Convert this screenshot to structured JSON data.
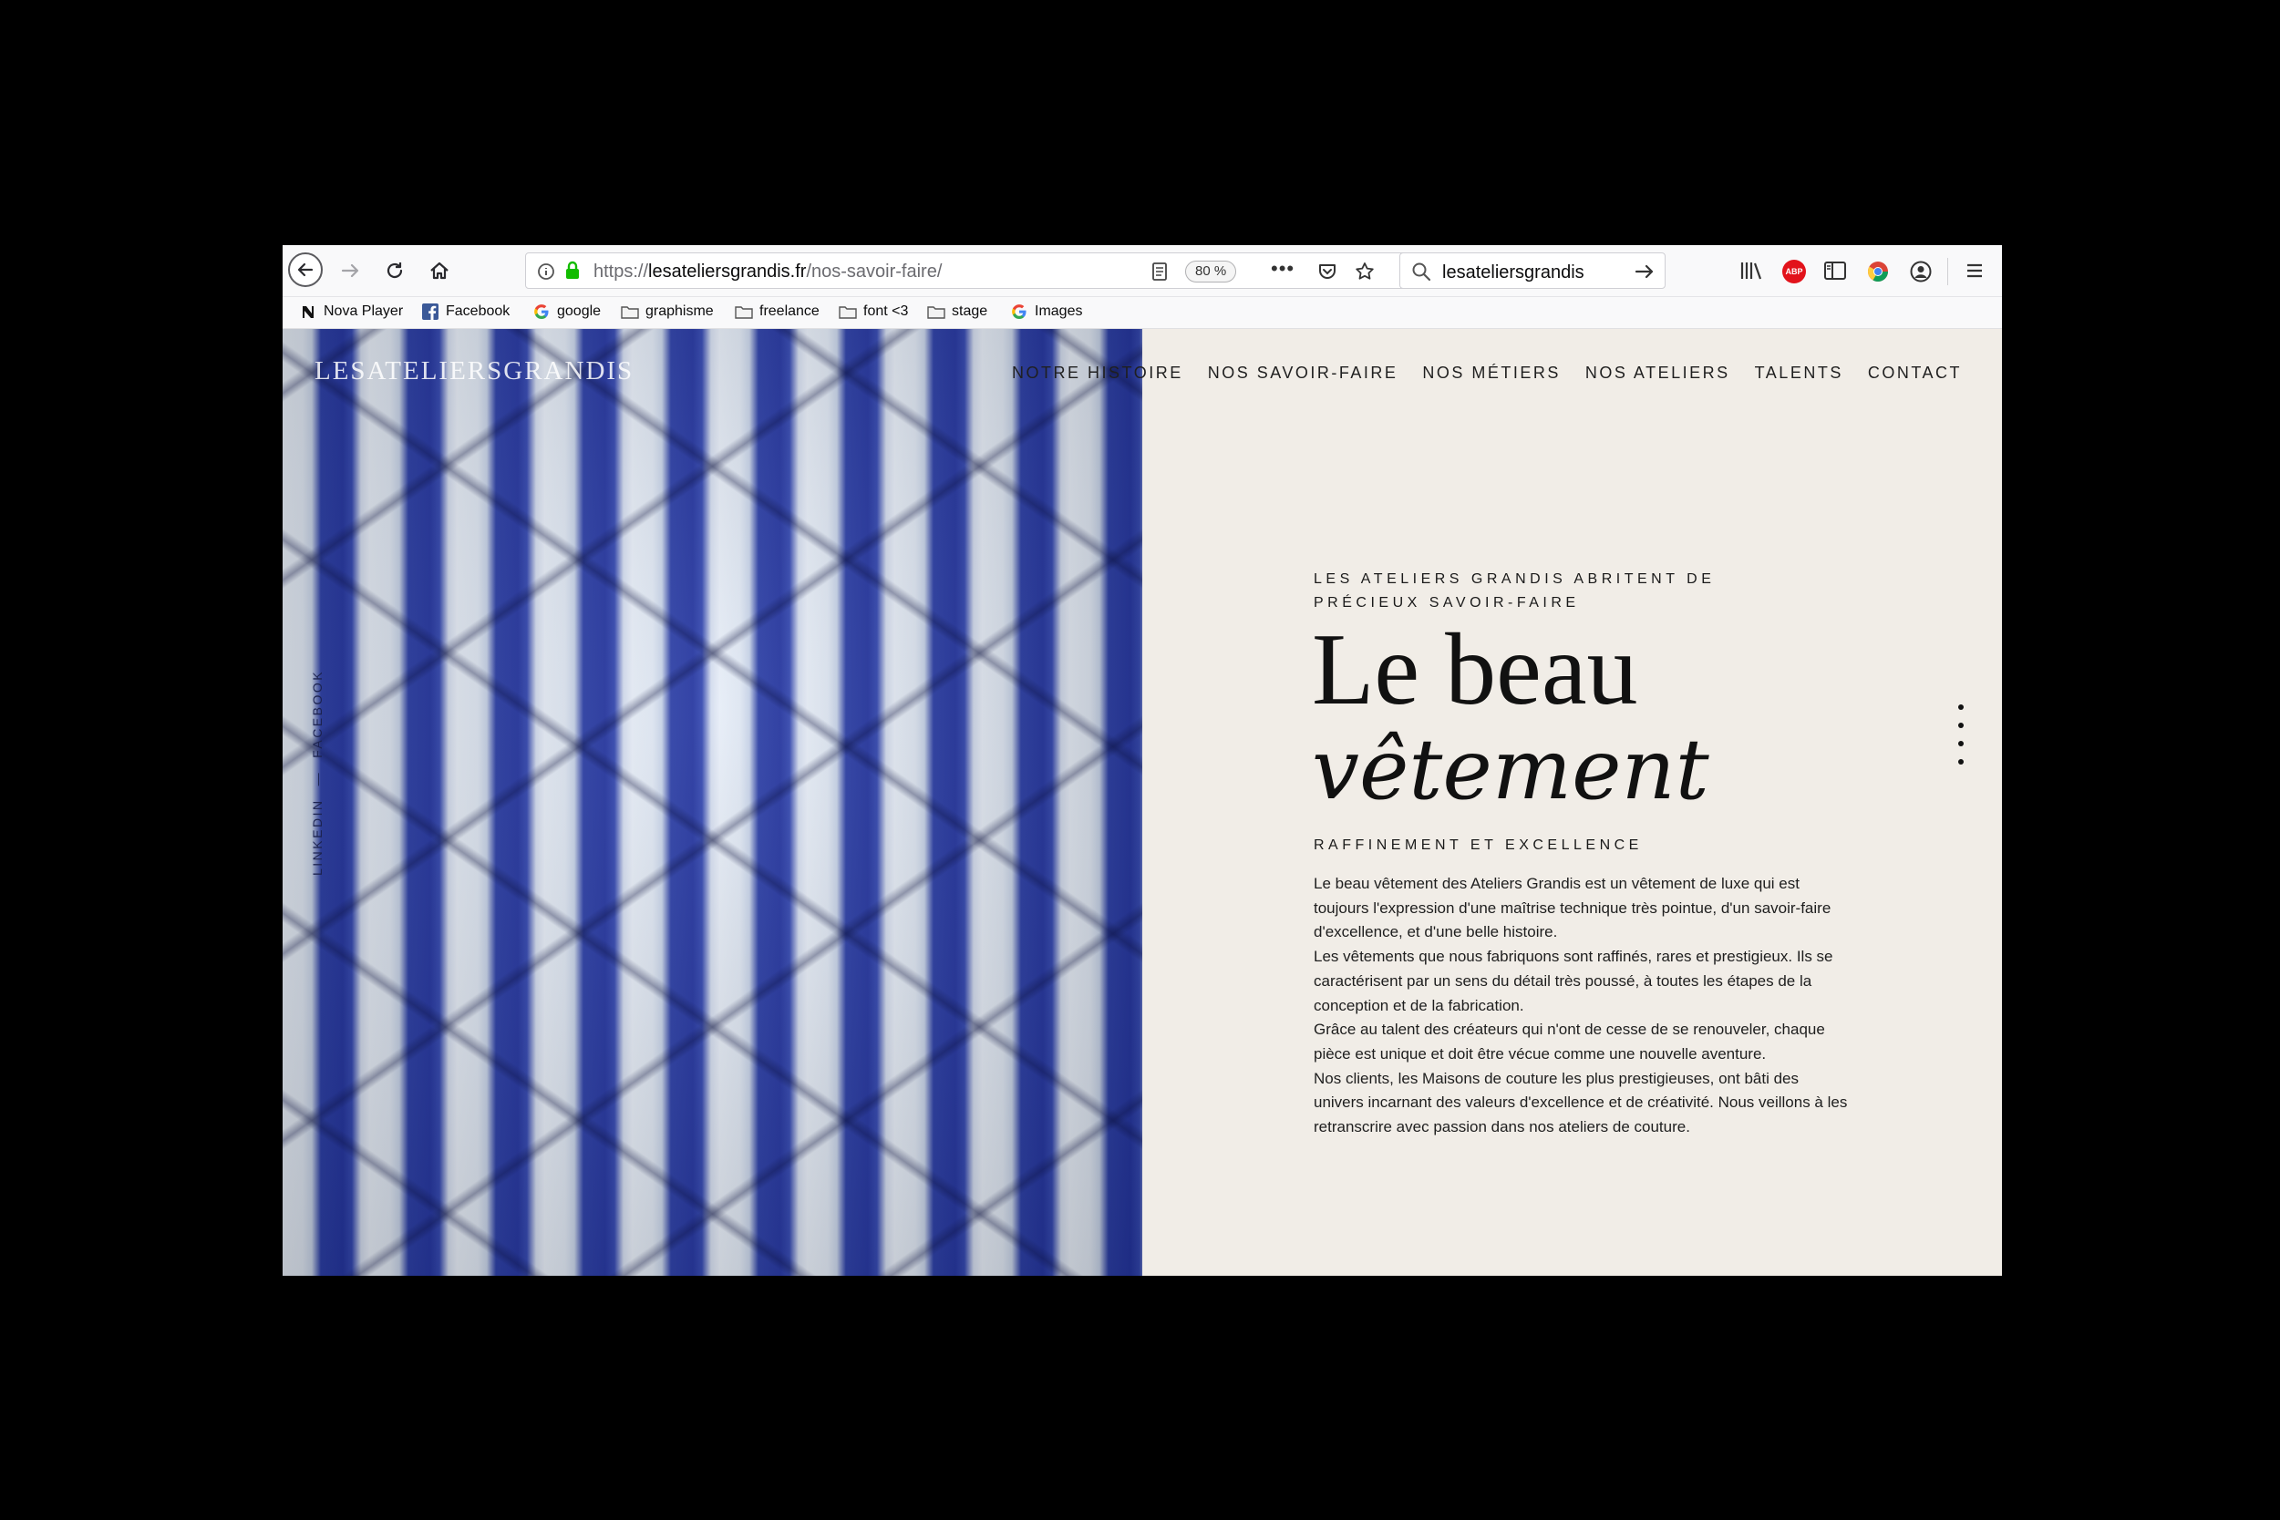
{
  "browser": {
    "url_secure_part": "https://",
    "url_domain": "lesateliersgrandis.fr",
    "url_path": "/nos-savoir-faire/",
    "zoom_level": "80 %",
    "search_value": "lesateliersgrandis"
  },
  "bookmarks": [
    {
      "label": "Nova Player",
      "icon": "nova-icon"
    },
    {
      "label": "Facebook",
      "icon": "facebook-icon"
    },
    {
      "label": "google",
      "icon": "google-icon"
    },
    {
      "label": "graphisme",
      "icon": "folder-icon"
    },
    {
      "label": "freelance",
      "icon": "folder-icon"
    },
    {
      "label": "font <3",
      "icon": "folder-icon"
    },
    {
      "label": "stage",
      "icon": "folder-icon"
    },
    {
      "label": "Images",
      "icon": "google-icon"
    }
  ],
  "site": {
    "logo": "LESATELIERSGRANDIS",
    "nav": [
      "NOTRE HISTOIRE",
      "NOS SAVOIR-FAIRE",
      "NOS MÉTIERS",
      "NOS ATELIERS",
      "TALENTS",
      "CONTACT"
    ],
    "socials": [
      "LINKEDIN",
      "—",
      "FACEBOOK"
    ]
  },
  "hero": {
    "kicker": "LES ATELIERS GRANDIS ABRITENT DE PRÉCIEUX SAVOIR-FAIRE",
    "title_line1": "Le beau",
    "title_line2": "vêtement",
    "subhead": "RAFFINEMENT ET EXCELLENCE",
    "paragraphs": [
      "Le beau vêtement des Ateliers Grandis est un vêtement de luxe qui est toujours l'expression d'une maîtrise technique très pointue, d'un savoir-faire d'excellence, et d'une belle histoire.",
      "Les vêtements que nous fabriquons sont raffinés, rares et prestigieux. Ils se caractérisent par un sens du détail très poussé, à toutes les étapes de la conception et de la fabrication.",
      "Grâce au talent des créateurs qui n'ont de cesse de se renouveler, chaque pièce est unique et doit être vécue comme une nouvelle aventure.",
      "Nos clients, les Maisons de couture les plus prestigieuses, ont bâti des univers incarnant des valeurs d'excellence et de créativité. Nous veillons à les retranscrire avec passion dans nos ateliers de couture."
    ]
  },
  "colors": {
    "page_bg": "#f1ede7",
    "stripe_blue": "#2b3ea6",
    "secure_green": "#12bc00"
  }
}
